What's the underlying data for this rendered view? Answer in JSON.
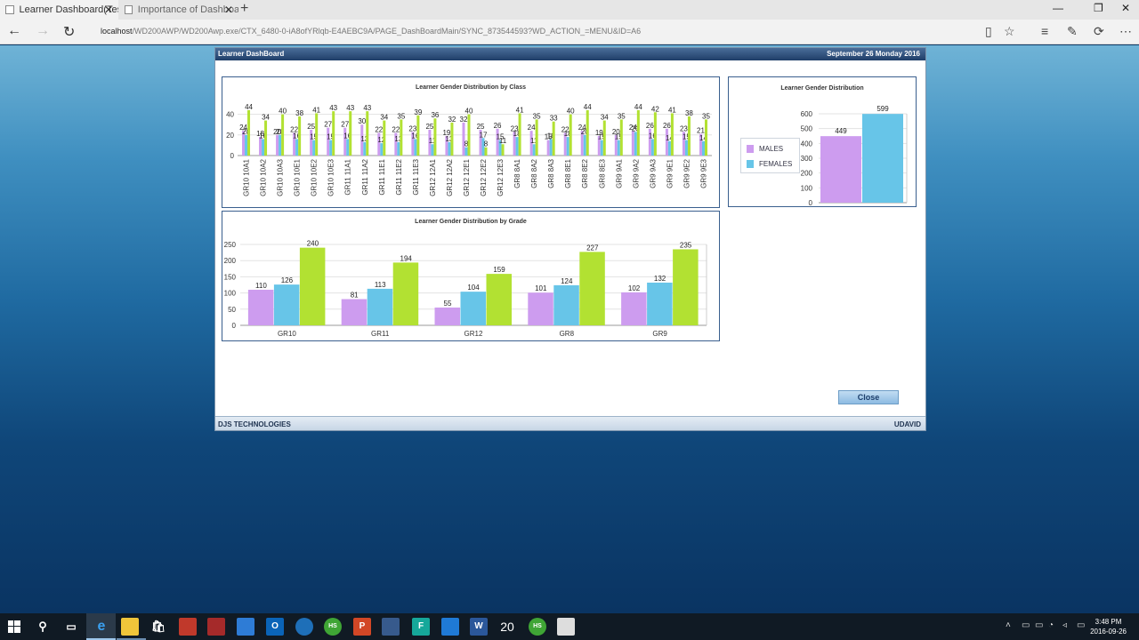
{
  "browser": {
    "tabs": [
      {
        "label": "Learner Dashboard(Test",
        "active": true
      },
      {
        "label": "Importance of Dashboard ir",
        "active": false
      }
    ],
    "url_host": "localhost",
    "url_path": "/WD200AWP/WD200Awp.exe/CTX_6480-0-iA8ofYRlqb-E4AEBC9A/PAGE_DashBoardMain/SYNC_873544593?WD_ACTION_=MENU&ID=A6"
  },
  "dashboard": {
    "title": "Learner DashBoard",
    "date": "September 26 Monday 2016",
    "footer_left": "DJS TECHNOLOGIES",
    "footer_right": "UDAVID",
    "close_label": "Close"
  },
  "colors": {
    "males": "#cd9cef",
    "females": "#67c5e8",
    "total": "#b2e132",
    "header": "#1f3e68"
  },
  "chart_data": [
    {
      "type": "bar",
      "title": "Learner Gender Distribution by Class",
      "categories": [
        "GR10 10A1",
        "GR10 10A2",
        "GR10 10A3",
        "GR10 10E1",
        "GR10 10E2",
        "GR10 10E3",
        "GR11 11A1",
        "GR11 11A2",
        "GR11 11E1",
        "GR11 11E2",
        "GR11 11E3",
        "GR12 12A1",
        "GR12 12A2",
        "GR12 12E1",
        "GR12 12E2",
        "GR12 12E3",
        "GR8 8A1",
        "GR8 8A2",
        "GR8 8A3",
        "GR8 8E1",
        "GR8 8E2",
        "GR8 8E3",
        "GR9 9A1",
        "GR9 9A2",
        "GR9 9A3",
        "GR9 9E1",
        "GR9 9E2",
        "GR9 9E3"
      ],
      "series": [
        {
          "values": [
            24,
            18,
            20,
            22,
            25,
            27,
            27,
            30,
            22,
            22,
            23,
            25,
            19,
            32,
            25,
            26,
            23,
            24,
            15,
            22,
            24,
            19,
            20,
            24,
            26,
            26,
            23,
            21
          ]
        },
        {
          "values": [
            20,
            16,
            20,
            16,
            15,
            15,
            16,
            13,
            12,
            13,
            16,
            11,
            13,
            8,
            17,
            15,
            18,
            11,
            16,
            18,
            20,
            15,
            15,
            23,
            16,
            14,
            15,
            14
          ]
        },
        {
          "values": [
            44,
            34,
            40,
            38,
            41,
            43,
            43,
            43,
            34,
            35,
            39,
            36,
            32,
            40,
            8,
            11,
            41,
            35,
            33,
            40,
            44,
            34,
            35,
            44,
            42,
            41,
            38,
            35
          ]
        }
      ],
      "ylim": [
        0,
        50
      ],
      "yticks": [
        0,
        20,
        40
      ]
    },
    {
      "type": "bar",
      "title": "Learner Gender Distribution by Grade",
      "categories": [
        "GR10",
        "GR11",
        "GR12",
        "GR8",
        "GR9"
      ],
      "series": [
        {
          "values": [
            110,
            81,
            55,
            101,
            102
          ]
        },
        {
          "values": [
            126,
            113,
            104,
            124,
            132
          ]
        },
        {
          "values": [
            240,
            194,
            159,
            227,
            235
          ]
        }
      ],
      "ylim": [
        0,
        250
      ],
      "yticks": [
        0,
        50,
        100,
        150,
        200,
        250
      ]
    },
    {
      "type": "bar",
      "title": "Learner Gender Distribution",
      "categories": [
        "MALES",
        "FEMALES"
      ],
      "values": [
        449,
        599
      ],
      "ylim": [
        0,
        600
      ],
      "yticks": [
        0,
        100,
        200,
        300,
        400,
        500,
        600
      ],
      "legend": [
        "MALES",
        "FEMALES"
      ],
      "legend_position": "left"
    }
  ],
  "taskbar": {
    "time": "3:48 PM",
    "date": "2016-09-26",
    "apps": [
      "start-icon",
      "search-icon",
      "task-view-icon",
      "edge-icon",
      "file-explorer-icon",
      "store-icon",
      "app-icon-1",
      "app-icon-2",
      "app-icon-3",
      "outlook-icon",
      "app-icon-4",
      "app-icon-5",
      "powerpoint-icon",
      "app-icon-6",
      "app-icon-7",
      "app-icon-8",
      "word-icon",
      "app-icon-9",
      "app-icon-10",
      "photos-icon"
    ],
    "app_20_label": "20"
  }
}
